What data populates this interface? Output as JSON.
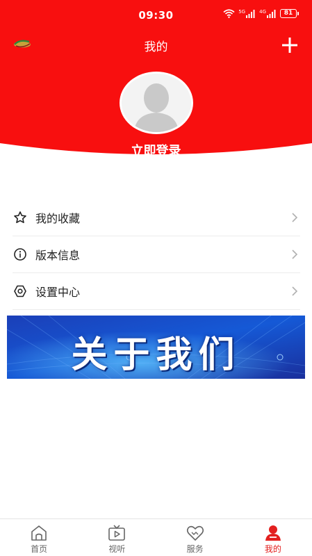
{
  "colors": {
    "brand_red": "#f80f0f",
    "text_dark": "#222222",
    "tab_inactive": "#666666",
    "tab_active": "#e3201f"
  },
  "status_bar": {
    "time": "09:30",
    "network_1": "5G",
    "network_2": "4G",
    "battery": "81"
  },
  "header": {
    "title": "我的",
    "login_text": "立即登录"
  },
  "menu": {
    "items": [
      {
        "label": "我的收藏",
        "icon": "star-icon"
      },
      {
        "label": "版本信息",
        "icon": "info-icon"
      },
      {
        "label": "设置中心",
        "icon": "settings-icon"
      }
    ]
  },
  "banner": {
    "text": "关于我们"
  },
  "tabbar": {
    "items": [
      {
        "label": "首页",
        "icon": "home-icon",
        "active": false
      },
      {
        "label": "视听",
        "icon": "tv-icon",
        "active": false
      },
      {
        "label": "服务",
        "icon": "heart-icon",
        "active": false
      },
      {
        "label": "我的",
        "icon": "profile-icon",
        "active": true
      }
    ]
  }
}
